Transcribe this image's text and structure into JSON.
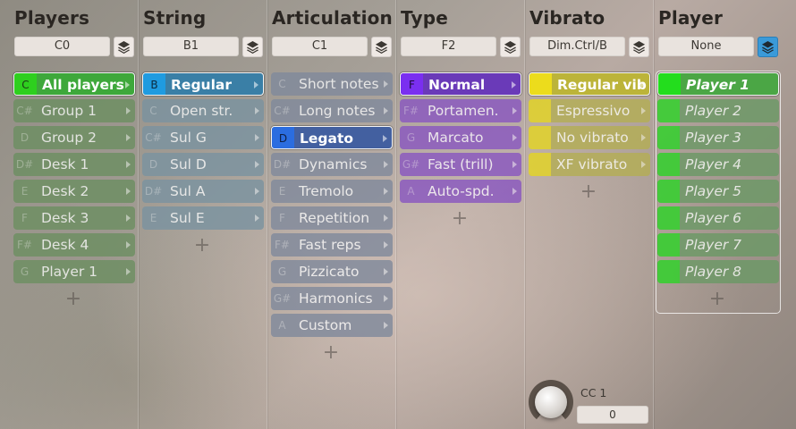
{
  "columns": [
    {
      "title": "Players",
      "field": "C0",
      "items": [
        {
          "key": "C",
          "label": "All players"
        },
        {
          "key": "C#",
          "label": "Group 1"
        },
        {
          "key": "D",
          "label": "Group 2"
        },
        {
          "key": "D#",
          "label": "Desk 1"
        },
        {
          "key": "E",
          "label": "Desk 2"
        },
        {
          "key": "F",
          "label": "Desk 3"
        },
        {
          "key": "F#",
          "label": "Desk 4"
        },
        {
          "key": "G",
          "label": "Player 1"
        }
      ]
    },
    {
      "title": "String",
      "field": "B1",
      "items": [
        {
          "key": "B",
          "label": "Regular"
        },
        {
          "key": "C",
          "label": "Open str."
        },
        {
          "key": "C#",
          "label": "Sul G"
        },
        {
          "key": "D",
          "label": "Sul D"
        },
        {
          "key": "D#",
          "label": "Sul A"
        },
        {
          "key": "E",
          "label": "Sul E"
        }
      ]
    },
    {
      "title": "Articulation",
      "field": "C1",
      "items": [
        {
          "key": "C",
          "label": "Short notes"
        },
        {
          "key": "C#",
          "label": "Long notes"
        },
        {
          "key": "D",
          "label": "Legato"
        },
        {
          "key": "D#",
          "label": "Dynamics"
        },
        {
          "key": "E",
          "label": "Tremolo"
        },
        {
          "key": "F",
          "label": "Repetition"
        },
        {
          "key": "F#",
          "label": "Fast reps"
        },
        {
          "key": "G",
          "label": "Pizzicato"
        },
        {
          "key": "G#",
          "label": "Harmonics"
        },
        {
          "key": "A",
          "label": "Custom"
        }
      ]
    },
    {
      "title": "Type",
      "field": "F2",
      "items": [
        {
          "key": "F",
          "label": "Normal"
        },
        {
          "key": "F#",
          "label": "Portamen."
        },
        {
          "key": "G",
          "label": "Marcato"
        },
        {
          "key": "G#",
          "label": "Fast (trill)"
        },
        {
          "key": "A",
          "label": "Auto-spd."
        }
      ]
    },
    {
      "title": "Vibrato",
      "field": "Dim.Ctrl/B",
      "items": [
        {
          "key": "",
          "label": "Regular vib"
        },
        {
          "key": "",
          "label": "Espressivo"
        },
        {
          "key": "",
          "label": "No vibrato"
        },
        {
          "key": "",
          "label": "XF vibrato"
        }
      ],
      "knob": {
        "label": "CC 1",
        "value": "0"
      }
    },
    {
      "title": "Player",
      "field": "None",
      "items": [
        {
          "key": "",
          "label": "Player 1"
        },
        {
          "key": "",
          "label": "Player 2"
        },
        {
          "key": "",
          "label": "Player 3"
        },
        {
          "key": "",
          "label": "Player 4"
        },
        {
          "key": "",
          "label": "Player 5"
        },
        {
          "key": "",
          "label": "Player 6"
        },
        {
          "key": "",
          "label": "Player 7"
        },
        {
          "key": "",
          "label": "Player 8"
        }
      ]
    }
  ],
  "plus_symbol": "+",
  "icons": {
    "layers": "layers-icon",
    "add": "add-icon",
    "arrow": "chevron-right-icon"
  },
  "colors": {
    "players_selected": "#3ea83b",
    "players_key": "#2ecf1e",
    "players_item": "#6d8f62",
    "string_selected": "#3a7fa6",
    "string_key": "#1f9be0",
    "string_item": "#7b93a0",
    "artic_selected": "#4360a0",
    "artic_key": "#2b6de0",
    "artic_item": "#818a9c",
    "type_selected": "#6a3ab8",
    "type_key": "#7a2ff0",
    "type_item": "#8a58c0",
    "vib_selected": "#bcb439",
    "vib_key": "#ecdc1c",
    "vib_item": "#b4ae55",
    "player_selected": "#4ba645",
    "player_key": "#23dd1d",
    "player_item": "#6c9966"
  }
}
